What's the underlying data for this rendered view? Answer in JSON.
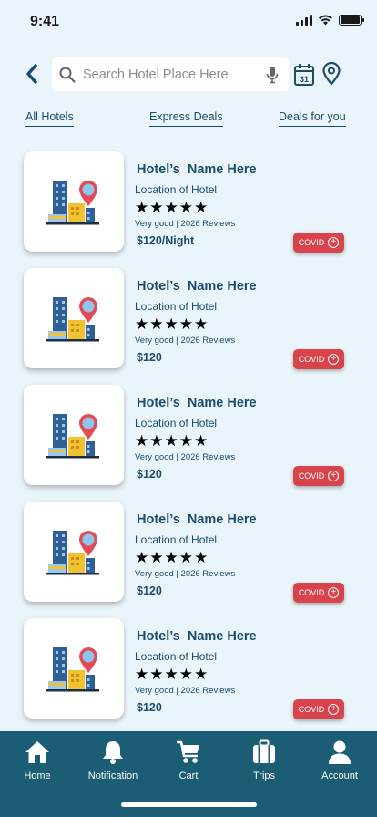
{
  "status": {
    "time": "9:41"
  },
  "search": {
    "placeholder": "Search Hotel Place Here"
  },
  "tabs": [
    {
      "label": "All Hotels"
    },
    {
      "label": "Express Deals"
    },
    {
      "label": "Deals for you"
    }
  ],
  "hotels": [
    {
      "name": "Hotel’s  Name Here",
      "location": "Location of Hotel",
      "rating": 5,
      "reviews": "Very good | 2026 Reviews",
      "price": "$120/Night",
      "covid_label": "COVID"
    },
    {
      "name": "Hotel’s  Name Here",
      "location": "Location of Hotel",
      "rating": 5,
      "reviews": "Very good | 2026 Reviews",
      "price": "$120",
      "covid_label": "COVID"
    },
    {
      "name": "Hotel’s  Name Here",
      "location": "Location of Hotel",
      "rating": 5,
      "reviews": "Very good | 2026 Reviews",
      "price": "$120",
      "covid_label": "COVID"
    },
    {
      "name": "Hotel’s  Name Here",
      "location": "Location of Hotel",
      "rating": 5,
      "reviews": "Very good | 2026 Reviews",
      "price": "$120",
      "covid_label": "COVID"
    },
    {
      "name": "Hotel’s  Name Here",
      "location": "Location of Hotel",
      "rating": 5,
      "reviews": "Very good | 2026 Reviews",
      "price": "$120",
      "covid_label": "COVID"
    }
  ],
  "nav": [
    {
      "label": "Home",
      "icon": "home-icon"
    },
    {
      "label": "Notification",
      "icon": "bell-icon"
    },
    {
      "label": "Cart",
      "icon": "cart-icon"
    },
    {
      "label": "Trips",
      "icon": "suitcase-icon"
    },
    {
      "label": "Account",
      "icon": "user-icon"
    }
  ],
  "colors": {
    "background": "#eaf4fb",
    "primary": "#1b4d6b",
    "nav_bar": "#1b5d75",
    "covid_button": "#d9434b"
  }
}
